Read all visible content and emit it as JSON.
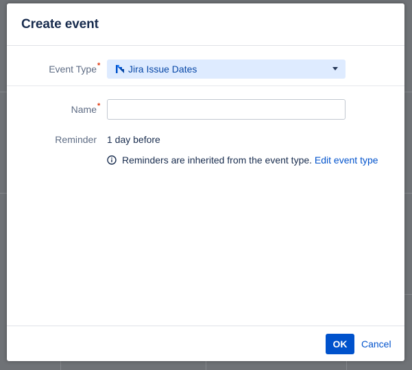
{
  "dialog": {
    "title": "Create event"
  },
  "form": {
    "event_type": {
      "label": "Event Type",
      "required_marker": "*",
      "selected_value": "Jira Issue Dates",
      "icon": "jira-icon"
    },
    "name": {
      "label": "Name",
      "required_marker": "*",
      "value": "",
      "placeholder": ""
    },
    "reminder": {
      "label": "Reminder",
      "value": "1 day before",
      "info_text": "Reminders are inherited from the event type.",
      "info_link": "Edit event type",
      "info_icon": "info-icon"
    }
  },
  "footer": {
    "ok_label": "OK",
    "cancel_label": "Cancel"
  },
  "colors": {
    "primary": "#0052cc",
    "select_background": "#deebff",
    "required": "#de350b",
    "overlay": "#6f7276"
  }
}
